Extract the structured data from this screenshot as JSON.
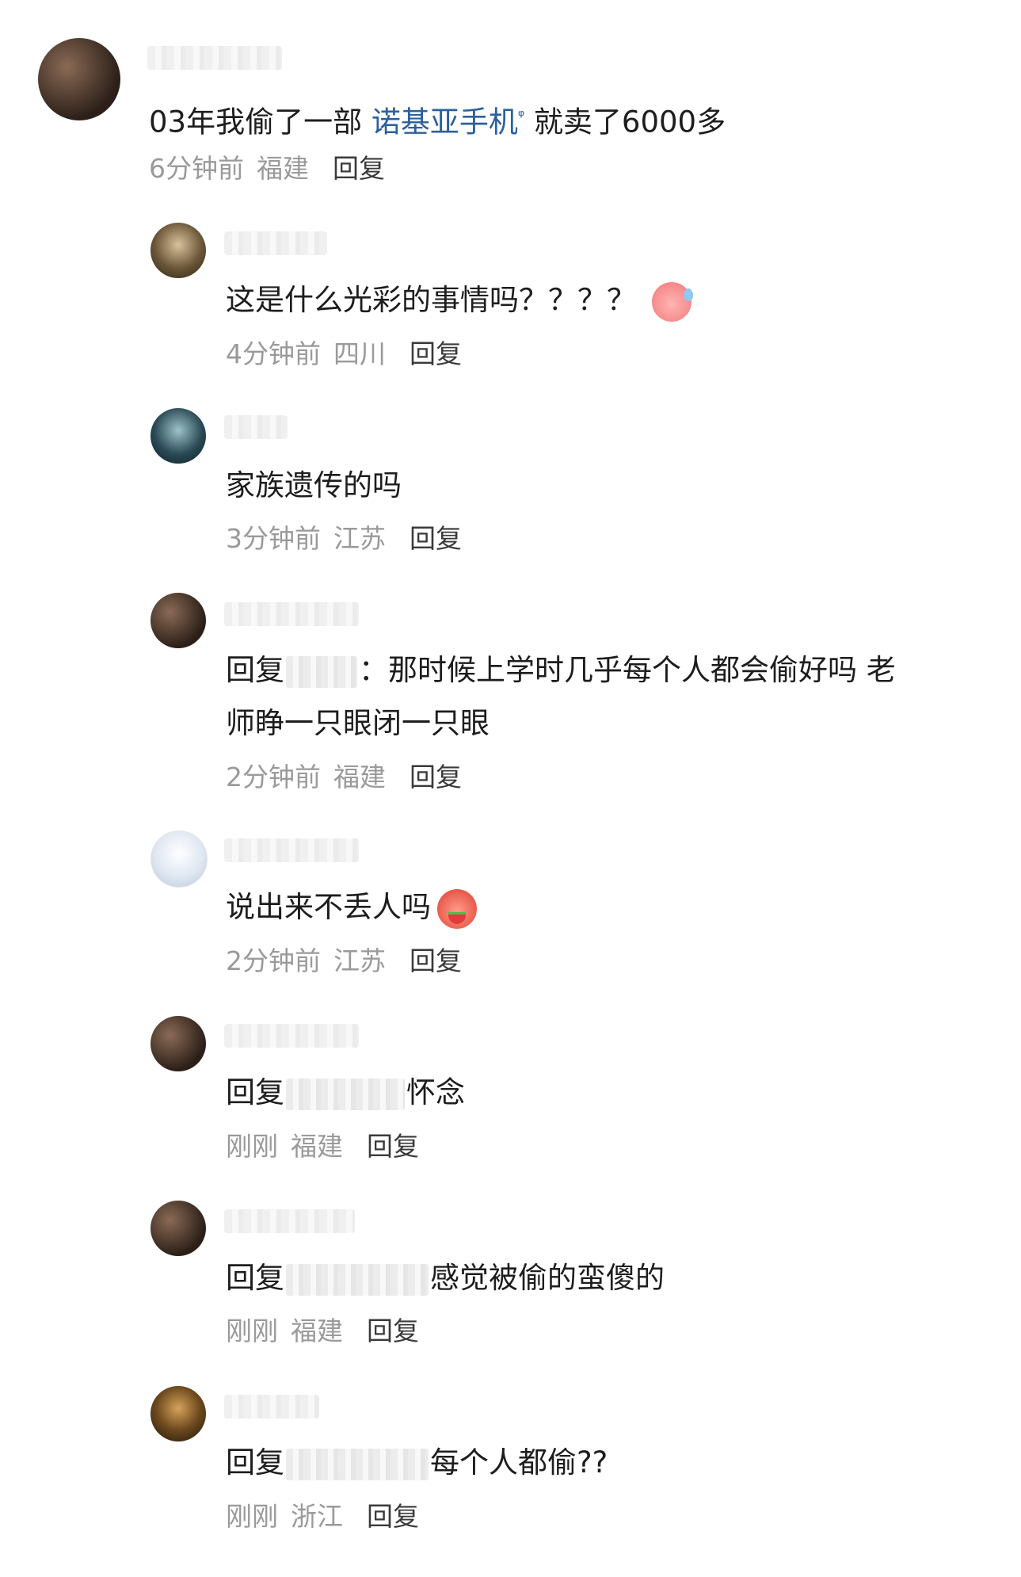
{
  "comments": [
    {
      "text_plain_1": "03年我偷了一部",
      "link": "诺基亚手机",
      "search_glyph": "ᵠ",
      "text_plain_2": "就卖了6000多",
      "time": "6分钟前",
      "region": "福建",
      "reply": "回复"
    },
    {
      "text": "这是什么光彩的事情吗？？？？",
      "emoji": "sweat-emoji",
      "time": "4分钟前",
      "region": "四川",
      "reply": "回复"
    },
    {
      "text": "家族遗传的吗",
      "time": "3分钟前",
      "region": "江苏",
      "reply": "回复"
    },
    {
      "prefix": "回复",
      "line1": "：那时候上学时几乎每个人都会偷好吗  老",
      "line2": "师睁一只眼闭一只眼",
      "time": "2分钟前",
      "region": "福建",
      "reply": "回复"
    },
    {
      "text": "说出来不丢人吗",
      "emoji": "watermelon-emoji",
      "time": "2分钟前",
      "region": "江苏",
      "reply": "回复"
    },
    {
      "prefix": "回复",
      "text": "怀念",
      "time": "刚刚",
      "region": "福建",
      "reply": "回复"
    },
    {
      "prefix": "回复",
      "text": "感觉被偷的蛮傻的",
      "time": "刚刚",
      "region": "福建",
      "reply": "回复"
    },
    {
      "prefix": "回复",
      "text": "每个人都偷??",
      "time": "刚刚",
      "region": "浙江",
      "reply": "回复"
    }
  ],
  "colors": {
    "link": "#2d5f9e",
    "meta": "#9a9a9a",
    "text": "#1d1d1d"
  }
}
